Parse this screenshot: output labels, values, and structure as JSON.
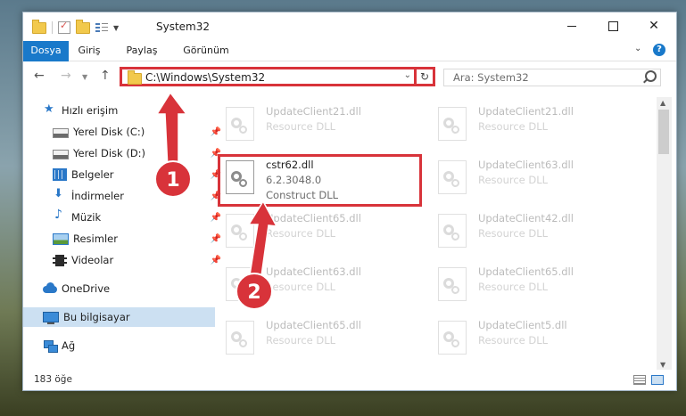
{
  "window": {
    "title": "System32",
    "minimize_icon": "minimize-icon",
    "maximize_icon": "maximize-icon",
    "close_icon": "close-icon"
  },
  "quick_access_toolbar": {
    "icons": [
      "folder-icon",
      "properties-check-icon",
      "new-folder-icon",
      "customize-icon"
    ]
  },
  "ribbon": {
    "file_tab": "Dosya",
    "tabs": [
      "Giriş",
      "Paylaş",
      "Görünüm"
    ],
    "help_label": "?"
  },
  "navigation": {
    "address": "C:\\Windows\\System32",
    "search_placeholder": "Ara: System32"
  },
  "sidebar": {
    "items": [
      {
        "label": "Hızlı erişim",
        "icon": "star-icon",
        "pinned": false
      },
      {
        "label": "Yerel Disk (C:)",
        "icon": "drive-icon",
        "pinned": true
      },
      {
        "label": "Yerel Disk (D:)",
        "icon": "drive-icon",
        "pinned": true
      },
      {
        "label": "Belgeler",
        "icon": "documents-icon",
        "pinned": true
      },
      {
        "label": "İndirmeler",
        "icon": "download-icon",
        "pinned": true
      },
      {
        "label": "Müzik",
        "icon": "music-icon",
        "pinned": true
      },
      {
        "label": "Resimler",
        "icon": "pictures-icon",
        "pinned": true
      },
      {
        "label": "Videolar",
        "icon": "videos-icon",
        "pinned": true
      },
      {
        "label": "OneDrive",
        "icon": "onedrive-icon",
        "pinned": false
      },
      {
        "label": "Bu bilgisayar",
        "icon": "this-pc-icon",
        "pinned": false,
        "selected": true
      },
      {
        "label": "Ağ",
        "icon": "network-icon",
        "pinned": false
      }
    ]
  },
  "files": {
    "items": [
      {
        "name": "UpdateClient21.dll",
        "type": "Resource DLL",
        "faded": true
      },
      {
        "name": "UpdateClient21.dll",
        "type": "Resource DLL",
        "faded": true
      },
      {
        "name": "cstr62.dll",
        "version": "6.2.3048.0",
        "type": "Construct DLL",
        "faded": false
      },
      {
        "name": "UpdateClient63.dll",
        "type": "Resource DLL",
        "faded": true
      },
      {
        "name": "UpdateClient65.dll",
        "type": "Resource DLL",
        "faded": true
      },
      {
        "name": "UpdateClient42.dll",
        "type": "Resource DLL",
        "faded": true
      },
      {
        "name": "UpdateClient63.dll",
        "type": "Resource DLL",
        "faded": true
      },
      {
        "name": "UpdateClient65.dll",
        "type": "Resource DLL",
        "faded": true
      },
      {
        "name": "UpdateClient65.dll",
        "type": "Resource DLL",
        "faded": true
      },
      {
        "name": "UpdateClient5.dll",
        "type": "Resource DLL",
        "faded": true
      }
    ]
  },
  "status": {
    "item_count": "183 öğe"
  },
  "annotations": {
    "step1": "1",
    "step2": "2",
    "accent_color": "#d8333a"
  },
  "colors": {
    "ribbon_file_tab": "#1979ca",
    "selection": "#cce0f2"
  }
}
